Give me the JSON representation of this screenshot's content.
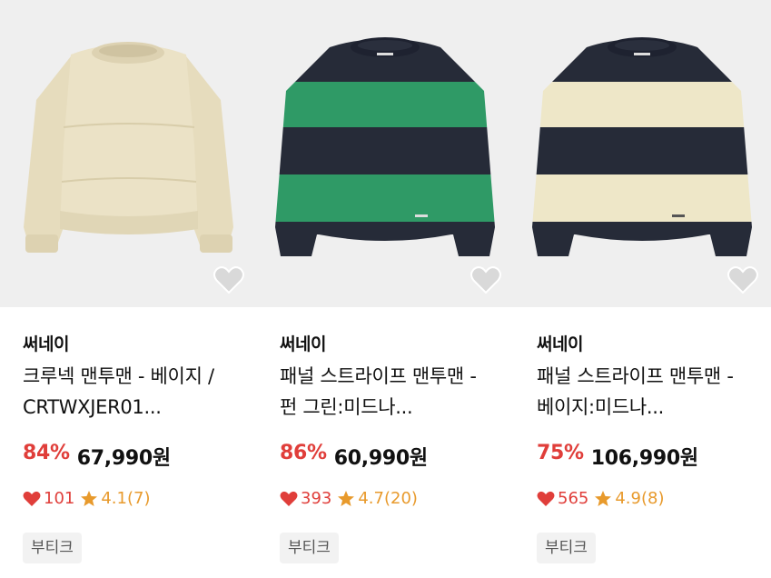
{
  "products": [
    {
      "brand": "써네이",
      "title": "크루넥 맨투맨 - 베이지 / CRTWXJER01...",
      "discount": "84%",
      "price": "67,990원",
      "likes": "101",
      "rating": "4.1(7)",
      "tag": "부티크",
      "image": "beige-crewneck-sweatshirt"
    },
    {
      "brand": "써네이",
      "title": "패널 스트라이프 맨투맨 - 펀 그린:미드나...",
      "discount": "86%",
      "price": "60,990원",
      "likes": "393",
      "rating": "4.7(20)",
      "tag": "부티크",
      "image": "green-navy-striped-sweatshirt"
    },
    {
      "brand": "써네이",
      "title": "패널 스트라이프 맨투맨 - 베이지:미드나...",
      "discount": "75%",
      "price": "106,990원",
      "likes": "565",
      "rating": "4.9(8)",
      "tag": "부티크",
      "image": "beige-navy-striped-sweatshirt"
    }
  ],
  "colors": {
    "discount": "#e03e3a",
    "heart": "#e03e3a",
    "star": "#e89a2c",
    "tag_bg": "#f2f2f2",
    "thumb_bg": "#efefef",
    "beige": "#e8dfc3",
    "navy": "#262b38",
    "green": "#2f9a66"
  }
}
